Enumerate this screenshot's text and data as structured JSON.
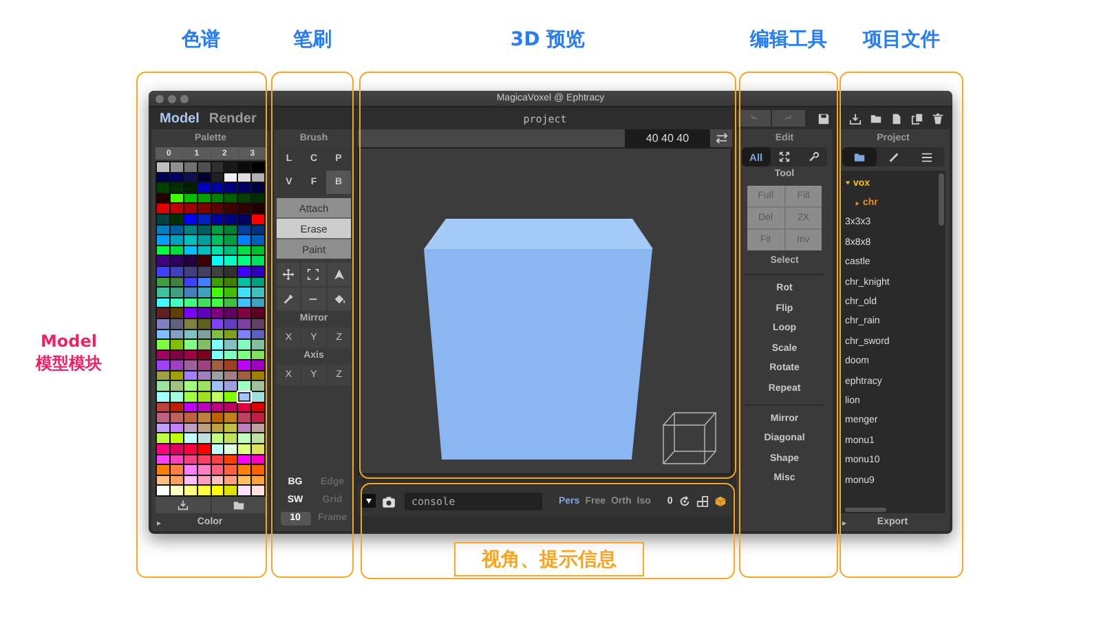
{
  "window": {
    "title": "MagicaVoxel @ Ephtracy"
  },
  "mode_tabs": [
    {
      "label": "Model",
      "selected": true
    },
    {
      "label": "Render",
      "selected": false
    }
  ],
  "palette": {
    "title": "Palette",
    "pages": [
      {
        "label": "0",
        "selected": false
      },
      {
        "label": "1",
        "selected": false
      },
      {
        "label": "2",
        "selected": false
      },
      {
        "label": "3",
        "selected": false
      }
    ],
    "rows": [
      [
        {
          "color": "#c0c0c0",
          "selected": false
        },
        {
          "color": "#909090",
          "selected": false
        },
        {
          "color": "#707070",
          "selected": false
        },
        {
          "color": "#505050",
          "selected": false
        },
        {
          "color": "#303030",
          "selected": false
        },
        {
          "color": "#181818",
          "selected": false
        },
        {
          "color": "#0a0a0a",
          "selected": false
        },
        {
          "color": "#000000",
          "selected": false
        }
      ],
      [
        {
          "color": "#000050",
          "selected": false
        },
        {
          "color": "#000060",
          "selected": false
        },
        {
          "color": "#101050",
          "selected": false
        },
        {
          "color": "#000030",
          "selected": false
        },
        {
          "color": "#202020",
          "selected": false
        },
        {
          "color": "#f0f0f0",
          "selected": false
        },
        {
          "color": "#e0e0e0",
          "selected": false
        },
        {
          "color": "#b0b0b0",
          "selected": false
        }
      ],
      [
        {
          "color": "#004000",
          "selected": false
        },
        {
          "color": "#003000",
          "selected": false
        },
        {
          "color": "#002000",
          "selected": false
        },
        {
          "color": "#0000c0",
          "selected": false
        },
        {
          "color": "#0000a0",
          "selected": false
        },
        {
          "color": "#000080",
          "selected": false
        },
        {
          "color": "#000060",
          "selected": false
        },
        {
          "color": "#000040",
          "selected": false
        }
      ],
      [
        {
          "color": "#200000",
          "selected": false
        },
        {
          "color": "#40ff00",
          "selected": false
        },
        {
          "color": "#00c000",
          "selected": false
        },
        {
          "color": "#00a000",
          "selected": false
        },
        {
          "color": "#008000",
          "selected": false
        },
        {
          "color": "#006000",
          "selected": false
        },
        {
          "color": "#004000",
          "selected": false
        },
        {
          "color": "#003000",
          "selected": false
        }
      ],
      [
        {
          "color": "#e00000",
          "selected": false
        },
        {
          "color": "#c00000",
          "selected": false
        },
        {
          "color": "#a00000",
          "selected": false
        },
        {
          "color": "#800000",
          "selected": false
        },
        {
          "color": "#600000",
          "selected": false
        },
        {
          "color": "#400000",
          "selected": false
        },
        {
          "color": "#300000",
          "selected": false
        },
        {
          "color": "#200000",
          "selected": false
        }
      ],
      [
        {
          "color": "#004040",
          "selected": false
        },
        {
          "color": "#003000",
          "selected": false
        },
        {
          "color": "#0000ff",
          "selected": false
        },
        {
          "color": "#0020c0",
          "selected": false
        },
        {
          "color": "#0000a0",
          "selected": false
        },
        {
          "color": "#000080",
          "selected": false
        },
        {
          "color": "#000060",
          "selected": false
        },
        {
          "color": "#ff0000",
          "selected": false
        }
      ],
      [
        {
          "color": "#0080c0",
          "selected": false
        },
        {
          "color": "#0060a0",
          "selected": false
        },
        {
          "color": "#008080",
          "selected": false
        },
        {
          "color": "#006060",
          "selected": false
        },
        {
          "color": "#00a040",
          "selected": false
        },
        {
          "color": "#008030",
          "selected": false
        },
        {
          "color": "#0040a0",
          "selected": false
        },
        {
          "color": "#003080",
          "selected": false
        }
      ],
      [
        {
          "color": "#00a0ff",
          "selected": false
        },
        {
          "color": "#00a0c0",
          "selected": false
        },
        {
          "color": "#00c0c0",
          "selected": false
        },
        {
          "color": "#00a0a0",
          "selected": false
        },
        {
          "color": "#00c060",
          "selected": false
        },
        {
          "color": "#00a040",
          "selected": false
        },
        {
          "color": "#0080ff",
          "selected": false
        },
        {
          "color": "#0060c0",
          "selected": false
        }
      ],
      [
        {
          "color": "#00ff40",
          "selected": false
        },
        {
          "color": "#00e040",
          "selected": false
        },
        {
          "color": "#00c0ff",
          "selected": false
        },
        {
          "color": "#00c0c0",
          "selected": false
        },
        {
          "color": "#00e0a0",
          "selected": false
        },
        {
          "color": "#00c080",
          "selected": false
        },
        {
          "color": "#00e040",
          "selected": false
        },
        {
          "color": "#00c030",
          "selected": false
        }
      ],
      [
        {
          "color": "#400080",
          "selected": false
        },
        {
          "color": "#300060",
          "selected": false
        },
        {
          "color": "#200040",
          "selected": false
        },
        {
          "color": "#400000",
          "selected": false
        },
        {
          "color": "#00ffff",
          "selected": false
        },
        {
          "color": "#00ffc0",
          "selected": false
        },
        {
          "color": "#00ff80",
          "selected": false
        },
        {
          "color": "#00e060",
          "selected": false
        }
      ],
      [
        {
          "color": "#4040ff",
          "selected": false
        },
        {
          "color": "#4040c0",
          "selected": false
        },
        {
          "color": "#404080",
          "selected": false
        },
        {
          "color": "#404060",
          "selected": false
        },
        {
          "color": "#404040",
          "selected": false
        },
        {
          "color": "#303030",
          "selected": false
        },
        {
          "color": "#4000ff",
          "selected": false
        },
        {
          "color": "#3000c0",
          "selected": false
        }
      ],
      [
        {
          "color": "#40a040",
          "selected": false
        },
        {
          "color": "#408040",
          "selected": false
        },
        {
          "color": "#4040ff",
          "selected": false
        },
        {
          "color": "#4080ff",
          "selected": false
        },
        {
          "color": "#40a000",
          "selected": false
        },
        {
          "color": "#408000",
          "selected": false
        },
        {
          "color": "#00c0a0",
          "selected": false
        },
        {
          "color": "#00a080",
          "selected": false
        }
      ],
      [
        {
          "color": "#40c0a0",
          "selected": false
        },
        {
          "color": "#40a080",
          "selected": false
        },
        {
          "color": "#4080c0",
          "selected": false
        },
        {
          "color": "#40a0c0",
          "selected": false
        },
        {
          "color": "#40ff00",
          "selected": false
        },
        {
          "color": "#40c000",
          "selected": false
        },
        {
          "color": "#40e0ff",
          "selected": false
        },
        {
          "color": "#40c0c0",
          "selected": false
        }
      ],
      [
        {
          "color": "#40ffff",
          "selected": false
        },
        {
          "color": "#40ffc0",
          "selected": false
        },
        {
          "color": "#40ff80",
          "selected": false
        },
        {
          "color": "#40e060",
          "selected": false
        },
        {
          "color": "#40ff40",
          "selected": false
        },
        {
          "color": "#40c040",
          "selected": false
        },
        {
          "color": "#40c0ff",
          "selected": false
        },
        {
          "color": "#40a0c0",
          "selected": false
        }
      ],
      [
        {
          "color": "#602020",
          "selected": false
        },
        {
          "color": "#604000",
          "selected": false
        },
        {
          "color": "#8000ff",
          "selected": false
        },
        {
          "color": "#6000c0",
          "selected": false
        },
        {
          "color": "#800080",
          "selected": false
        },
        {
          "color": "#600060",
          "selected": false
        },
        {
          "color": "#800040",
          "selected": false
        },
        {
          "color": "#600020",
          "selected": false
        }
      ],
      [
        {
          "color": "#8080c0",
          "selected": false
        },
        {
          "color": "#606080",
          "selected": false
        },
        {
          "color": "#808040",
          "selected": false
        },
        {
          "color": "#606020",
          "selected": false
        },
        {
          "color": "#8040ff",
          "selected": false
        },
        {
          "color": "#6040c0",
          "selected": false
        },
        {
          "color": "#8040a0",
          "selected": false
        },
        {
          "color": "#604060",
          "selected": false
        }
      ],
      [
        {
          "color": "#80c0ff",
          "selected": false
        },
        {
          "color": "#80a0c0",
          "selected": false
        },
        {
          "color": "#80c0c0",
          "selected": false
        },
        {
          "color": "#80a0a0",
          "selected": false
        },
        {
          "color": "#80c040",
          "selected": false
        },
        {
          "color": "#80a020",
          "selected": false
        },
        {
          "color": "#8080ff",
          "selected": false
        },
        {
          "color": "#6060c0",
          "selected": false
        }
      ],
      [
        {
          "color": "#80ff40",
          "selected": false
        },
        {
          "color": "#80c000",
          "selected": false
        },
        {
          "color": "#80ff80",
          "selected": false
        },
        {
          "color": "#80c060",
          "selected": false
        },
        {
          "color": "#80ffff",
          "selected": false
        },
        {
          "color": "#80c0c0",
          "selected": false
        },
        {
          "color": "#80ffc0",
          "selected": false
        },
        {
          "color": "#80c0a0",
          "selected": false
        }
      ],
      [
        {
          "color": "#a00060",
          "selected": false
        },
        {
          "color": "#800040",
          "selected": false
        },
        {
          "color": "#a00040",
          "selected": false
        },
        {
          "color": "#800020",
          "selected": false
        },
        {
          "color": "#80ffff",
          "selected": false
        },
        {
          "color": "#80ffc0",
          "selected": false
        },
        {
          "color": "#80ff80",
          "selected": false
        },
        {
          "color": "#80e060",
          "selected": false
        }
      ],
      [
        {
          "color": "#a040ff",
          "selected": false
        },
        {
          "color": "#a040c0",
          "selected": false
        },
        {
          "color": "#a060a0",
          "selected": false
        },
        {
          "color": "#a04080",
          "selected": false
        },
        {
          "color": "#a06040",
          "selected": false
        },
        {
          "color": "#a04020",
          "selected": false
        },
        {
          "color": "#c000ff",
          "selected": false
        },
        {
          "color": "#a000c0",
          "selected": false
        }
      ],
      [
        {
          "color": "#a0a040",
          "selected": false
        },
        {
          "color": "#a0a000",
          "selected": false
        },
        {
          "color": "#a080ff",
          "selected": false
        },
        {
          "color": "#a080c0",
          "selected": false
        },
        {
          "color": "#a0a0a0",
          "selected": false
        },
        {
          "color": "#a08080",
          "selected": false
        },
        {
          "color": "#a06040",
          "selected": false
        },
        {
          "color": "#a08000",
          "selected": false
        }
      ],
      [
        {
          "color": "#a0e0a0",
          "selected": false
        },
        {
          "color": "#a0c080",
          "selected": false
        },
        {
          "color": "#a0ff80",
          "selected": false
        },
        {
          "color": "#a0e060",
          "selected": false
        },
        {
          "color": "#a0c0ff",
          "selected": false
        },
        {
          "color": "#a0a0e0",
          "selected": false
        },
        {
          "color": "#a0ffc0",
          "selected": false
        },
        {
          "color": "#a0c0a0",
          "selected": false
        }
      ],
      [
        {
          "color": "#a0ffff",
          "selected": false
        },
        {
          "color": "#a0ffe0",
          "selected": false
        },
        {
          "color": "#a0ff40",
          "selected": false
        },
        {
          "color": "#a0e020",
          "selected": false
        },
        {
          "color": "#c0ff60",
          "selected": false
        },
        {
          "color": "#80ff00",
          "selected": false
        },
        {
          "color": "#a0c8ff",
          "selected": true
        },
        {
          "color": "#a0e0e0",
          "selected": false
        }
      ],
      [
        {
          "color": "#c04040",
          "selected": false
        },
        {
          "color": "#c02000",
          "selected": false
        },
        {
          "color": "#c000ff",
          "selected": false
        },
        {
          "color": "#c000c0",
          "selected": false
        },
        {
          "color": "#c00080",
          "selected": false
        },
        {
          "color": "#c00060",
          "selected": false
        },
        {
          "color": "#e00040",
          "selected": false
        },
        {
          "color": "#e00000",
          "selected": false
        }
      ],
      [
        {
          "color": "#c06080",
          "selected": false
        },
        {
          "color": "#c06060",
          "selected": false
        },
        {
          "color": "#c06040",
          "selected": false
        },
        {
          "color": "#c08040",
          "selected": false
        },
        {
          "color": "#c06000",
          "selected": false
        },
        {
          "color": "#c08020",
          "selected": false
        },
        {
          "color": "#c04060",
          "selected": false
        },
        {
          "color": "#c02040",
          "selected": false
        }
      ],
      [
        {
          "color": "#c0a0ff",
          "selected": false
        },
        {
          "color": "#c080ff",
          "selected": false
        },
        {
          "color": "#c0a0c0",
          "selected": false
        },
        {
          "color": "#c0a080",
          "selected": false
        },
        {
          "color": "#c0a040",
          "selected": false
        },
        {
          "color": "#c0c040",
          "selected": false
        },
        {
          "color": "#c080c0",
          "selected": false
        },
        {
          "color": "#c0a0a0",
          "selected": false
        }
      ],
      [
        {
          "color": "#c0ff40",
          "selected": false
        },
        {
          "color": "#c0ff00",
          "selected": false
        },
        {
          "color": "#c0ffff",
          "selected": false
        },
        {
          "color": "#c0e0e0",
          "selected": false
        },
        {
          "color": "#c0ff80",
          "selected": false
        },
        {
          "color": "#c0e060",
          "selected": false
        },
        {
          "color": "#c0ffc0",
          "selected": false
        },
        {
          "color": "#c0e0a0",
          "selected": false
        }
      ],
      [
        {
          "color": "#ff0080",
          "selected": false
        },
        {
          "color": "#e00060",
          "selected": false
        },
        {
          "color": "#ff0040",
          "selected": false
        },
        {
          "color": "#ff0000",
          "selected": false
        },
        {
          "color": "#c0ffff",
          "selected": false
        },
        {
          "color": "#e0ffe0",
          "selected": false
        },
        {
          "color": "#e0ff80",
          "selected": false
        },
        {
          "color": "#e0e060",
          "selected": false
        }
      ],
      [
        {
          "color": "#ff40ff",
          "selected": false
        },
        {
          "color": "#ff40c0",
          "selected": false
        },
        {
          "color": "#ff4080",
          "selected": false
        },
        {
          "color": "#ff4060",
          "selected": false
        },
        {
          "color": "#ff4040",
          "selected": false
        },
        {
          "color": "#ff4000",
          "selected": false
        },
        {
          "color": "#ff00ff",
          "selected": false
        },
        {
          "color": "#ff00c0",
          "selected": false
        }
      ],
      [
        {
          "color": "#ff8000",
          "selected": false
        },
        {
          "color": "#ff8040",
          "selected": false
        },
        {
          "color": "#ff80ff",
          "selected": false
        },
        {
          "color": "#ff80c0",
          "selected": false
        },
        {
          "color": "#ff6080",
          "selected": false
        },
        {
          "color": "#ff6040",
          "selected": false
        },
        {
          "color": "#ff8000",
          "selected": false
        },
        {
          "color": "#ff6000",
          "selected": false
        }
      ],
      [
        {
          "color": "#ffc080",
          "selected": false
        },
        {
          "color": "#ffa060",
          "selected": false
        },
        {
          "color": "#ffc0ff",
          "selected": false
        },
        {
          "color": "#ffa0c0",
          "selected": false
        },
        {
          "color": "#ffc0c0",
          "selected": false
        },
        {
          "color": "#ffa080",
          "selected": false
        },
        {
          "color": "#ffc060",
          "selected": false
        },
        {
          "color": "#ffa040",
          "selected": false
        }
      ],
      [
        {
          "color": "#ffffff",
          "selected": false
        },
        {
          "color": "#ffffc0",
          "selected": false
        },
        {
          "color": "#ffff80",
          "selected": false
        },
        {
          "color": "#ffff40",
          "selected": false
        },
        {
          "color": "#ffff00",
          "selected": false
        },
        {
          "color": "#e0e000",
          "selected": false
        },
        {
          "color": "#ffe0ff",
          "selected": false
        },
        {
          "color": "#ffe0e0",
          "selected": false
        }
      ]
    ],
    "footer": {
      "arrow": "▸",
      "label": "Color"
    }
  },
  "brush": {
    "title": "Brush",
    "shapes": [
      {
        "label": "L",
        "selected": false
      },
      {
        "label": "C",
        "selected": false
      },
      {
        "label": "P",
        "selected": false
      },
      {
        "label": "V",
        "selected": false
      },
      {
        "label": "F",
        "selected": false
      },
      {
        "label": "B",
        "selected": true
      }
    ],
    "modes": [
      {
        "label": "Attach",
        "selected": false
      },
      {
        "label": "Erase",
        "selected": true
      },
      {
        "label": "Paint",
        "selected": false
      }
    ],
    "mirror": {
      "title": "Mirror",
      "axes": [
        {
          "label": "X",
          "selected": false
        },
        {
          "label": "Y",
          "selected": false
        },
        {
          "label": "Z",
          "selected": false
        }
      ]
    },
    "axis": {
      "title": "Axis",
      "axes": [
        {
          "label": "X",
          "selected": false
        },
        {
          "label": "Y",
          "selected": false
        },
        {
          "label": "Z",
          "selected": false
        }
      ]
    },
    "options": [
      {
        "kind": "toggle",
        "label": "BG",
        "on": true
      },
      {
        "kind": "toggle",
        "label": "Edge",
        "on": false
      },
      {
        "kind": "toggle",
        "label": "SW",
        "on": true
      },
      {
        "kind": "toggle",
        "label": "Grid",
        "on": false
      },
      {
        "kind": "field",
        "value": "10"
      },
      {
        "kind": "toggle",
        "label": "Frame",
        "on": false
      }
    ]
  },
  "viewport": {
    "project_name": "project",
    "size": "40 40 40",
    "console": {
      "placeholder": "console"
    },
    "views": [
      {
        "label": "Pers",
        "selected": true
      },
      {
        "label": "Free",
        "selected": false
      },
      {
        "label": "Orth",
        "selected": false
      },
      {
        "label": "Iso",
        "selected": false
      }
    ],
    "counter": "0"
  },
  "edit": {
    "history": [
      {
        "disabled": true
      },
      {
        "disabled": true
      }
    ],
    "title": "Edit",
    "scopes": [
      {
        "kind": "text",
        "label": "All",
        "selected": true
      },
      {
        "kind": "icon",
        "selected": false
      },
      {
        "kind": "icon",
        "selected": false
      }
    ],
    "tool_title": "Tool",
    "tools": [
      "Full",
      "Fill",
      "Del",
      "2X",
      "Fit",
      "Inv"
    ],
    "select_label": "Select",
    "actions": [
      "Rot",
      "Flip",
      "Loop",
      "Scale",
      "Rotate",
      "Repeat"
    ],
    "more_actions": [
      "Mirror",
      "Diagonal",
      "Shape",
      "Misc"
    ]
  },
  "project": {
    "title": "Project",
    "tabs": [
      {
        "selected": true
      },
      {
        "selected": false
      },
      {
        "selected": false
      }
    ],
    "tree": [
      {
        "label": "vox",
        "kind": "folder",
        "expanded": true,
        "color": "#f5c518",
        "children": [
          {
            "label": "chr",
            "kind": "folder",
            "expanded": false,
            "color": "#f08a24"
          }
        ]
      },
      {
        "label": "3x3x3",
        "kind": "file"
      },
      {
        "label": "8x8x8",
        "kind": "file"
      },
      {
        "label": "castle",
        "kind": "file"
      },
      {
        "label": "chr_knight",
        "kind": "file"
      },
      {
        "label": "chr_old",
        "kind": "file"
      },
      {
        "label": "chr_rain",
        "kind": "file"
      },
      {
        "label": "chr_sword",
        "kind": "file"
      },
      {
        "label": "doom",
        "kind": "file"
      },
      {
        "label": "ephtracy",
        "kind": "file"
      },
      {
        "label": "lion",
        "kind": "file"
      },
      {
        "label": "menger",
        "kind": "file"
      },
      {
        "label": "monu1",
        "kind": "file"
      },
      {
        "label": "monu10",
        "kind": "file"
      },
      {
        "label": "monu9",
        "kind": "file"
      }
    ],
    "footer": {
      "arrow": "▸",
      "label": "Export"
    }
  },
  "annotations": {
    "section_labels": [
      "色谱",
      "笔刷",
      "3D 预览",
      "编辑工具",
      "项目文件"
    ],
    "side_label": [
      "Model",
      "模型模块"
    ],
    "bottom_label": "视角、提示信息"
  }
}
